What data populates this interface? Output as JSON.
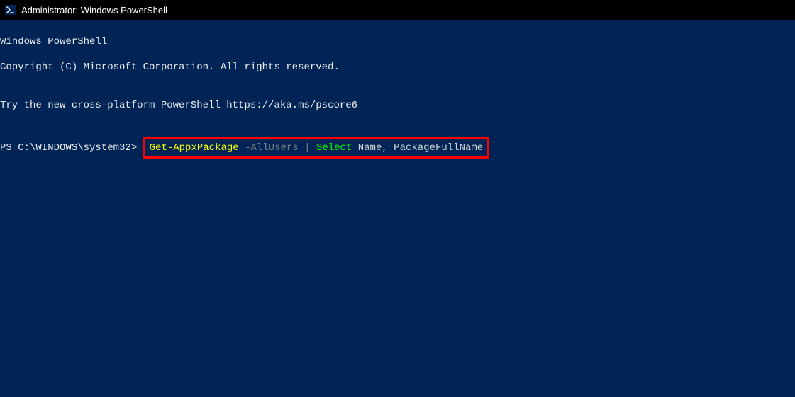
{
  "window": {
    "title": "Administrator: Windows PowerShell"
  },
  "console": {
    "banner_line1": "Windows PowerShell",
    "banner_line2": "Copyright (C) Microsoft Corporation. All rights reserved.",
    "blank1": "",
    "tip_line": "Try the new cross-platform PowerShell https://aka.ms/pscore6",
    "blank2": "",
    "prompt_path": "PS C:\\WINDOWS\\system32> ",
    "command_tokens": {
      "cmdlet": "Get-AppxPackage",
      "sp1": " ",
      "param": "-AllUsers",
      "sp2": " ",
      "pipe": "|",
      "sp3": " ",
      "select_kw": "Select",
      "sp4": " ",
      "arg1": "Name",
      "comma": ",",
      "sp5": " ",
      "arg2": "PackageFullName"
    }
  }
}
